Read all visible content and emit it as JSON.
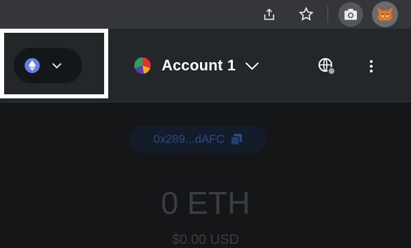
{
  "browser_toolbar": {
    "icons": [
      "share-icon",
      "star-icon",
      "camera-icon",
      "metamask-fox-icon"
    ]
  },
  "network_selector": {
    "network_icon": "ethereum-icon",
    "chevron_icon": "chevron-down-icon"
  },
  "account": {
    "name": "Account 1",
    "avatar_icon": "account-avatar",
    "chevron_icon": "chevron-down-icon"
  },
  "header_actions": {
    "connected_sites_icon": "globe-connected-icon",
    "menu_icon": "kebab-menu-icon"
  },
  "wallet": {
    "address": "0x289...dAFC",
    "copy_icon": "copy-icon",
    "balance": "0 ETH",
    "fiat_balance": "$0.00 USD"
  },
  "colors": {
    "header_bg": "#24272a",
    "body_bg": "#141618",
    "browser_bar_bg": "#35363a",
    "highlight_border": "#ffffff",
    "eth_blue": "#627eea",
    "address_text": "#2a4a86"
  }
}
